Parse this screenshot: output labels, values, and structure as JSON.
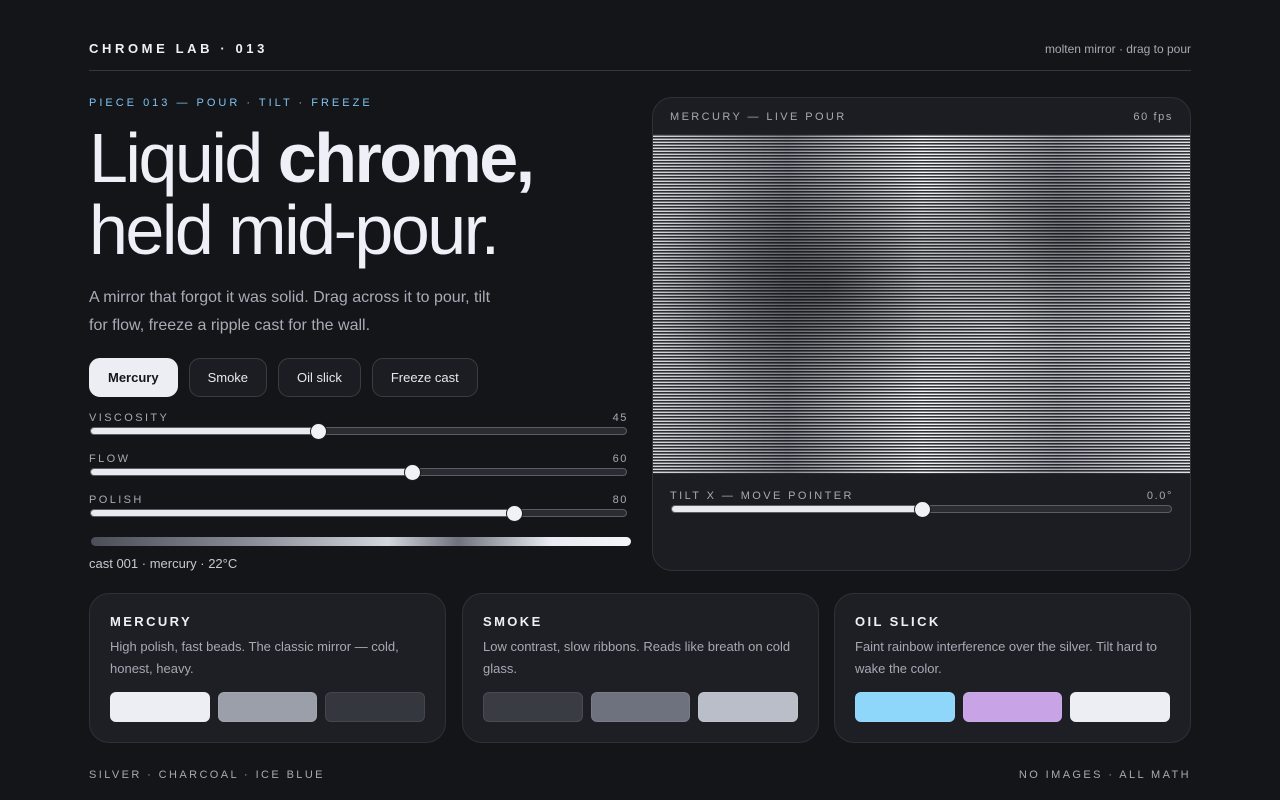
{
  "header": {
    "brand": "CHROME LAB · 013",
    "tagline": "molten mirror · drag to pour"
  },
  "hero": {
    "eyebrow": "PIECE 013 — POUR · TILT · FREEZE",
    "title_plain": "Liquid ",
    "title_bold": "chrome,",
    "title_line2": "held mid-pour.",
    "lede": "A mirror that forgot it was solid. Drag across it to pour, tilt for flow, freeze a ripple cast for the wall."
  },
  "modes": [
    {
      "label": "Mercury",
      "active": true
    },
    {
      "label": "Smoke",
      "active": false
    },
    {
      "label": "Oil slick",
      "active": false
    },
    {
      "label": "Freeze cast",
      "active": false
    }
  ],
  "sliders": [
    {
      "label": "VISCOSITY",
      "value": "45",
      "level": 0.425
    },
    {
      "label": "FLOW",
      "value": "60",
      "level": 0.6
    },
    {
      "label": "POLISH",
      "value": "80",
      "level": 0.79
    }
  ],
  "cast_status": "cast 001 · mercury · 22°C",
  "stage": {
    "title": "MERCURY — LIVE POUR",
    "fps": "60 fps",
    "tilt_label": "TILT X — MOVE POINTER",
    "tilt_value": "0.0°",
    "tilt_level": 0.5
  },
  "cards": [
    {
      "title": "MERCURY",
      "desc": "High polish, fast beads. The classic mirror — cold, honest, heavy.",
      "swatches": [
        "#eceef4",
        "#9b9fa9",
        "#35373e"
      ]
    },
    {
      "title": "SMOKE",
      "desc": "Low contrast, slow ribbons. Reads like breath on cold glass.",
      "swatches": [
        "#3a3c44",
        "#6e727e",
        "#babec8"
      ]
    },
    {
      "title": "OIL SLICK",
      "desc": "Faint rainbow interference over the silver. Tilt hard to wake the color.",
      "swatches": [
        "#8fd6fb",
        "#c8a3e6",
        "#eceef4"
      ]
    }
  ],
  "footer": {
    "left": "SILVER · CHARCOAL · ICE BLUE",
    "right": "NO IMAGES · ALL MATH"
  }
}
